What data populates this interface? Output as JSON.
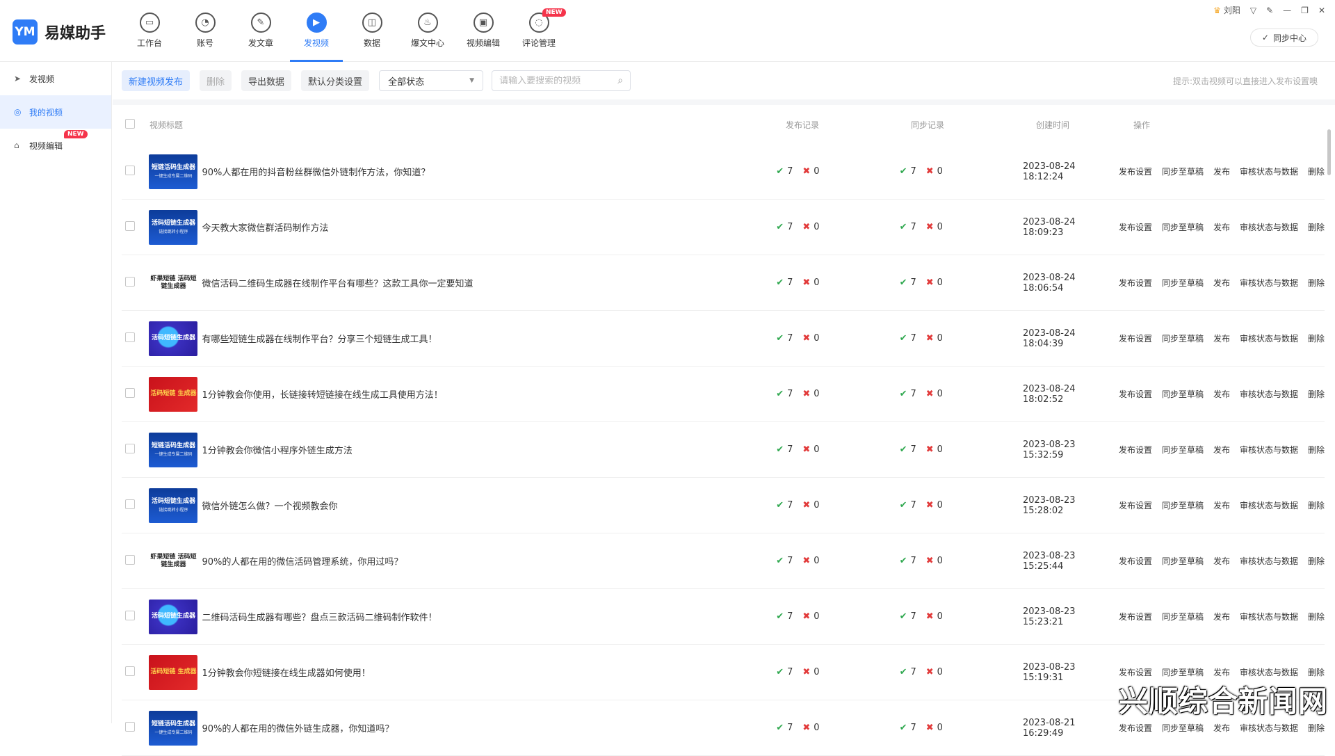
{
  "app": {
    "logo_mark": "YM",
    "name": "易媒助手"
  },
  "nav": [
    {
      "label": "工作台",
      "icon": "monitor-icon",
      "glyph": "▭"
    },
    {
      "label": "账号",
      "icon": "user-icon",
      "glyph": "◔"
    },
    {
      "label": "发文章",
      "icon": "feather-icon",
      "glyph": "✎"
    },
    {
      "label": "发视频",
      "icon": "play-icon",
      "glyph": "▶",
      "active": true
    },
    {
      "label": "数据",
      "icon": "chart-icon",
      "glyph": "◫"
    },
    {
      "label": "爆文中心",
      "icon": "flame-icon",
      "glyph": "♨"
    },
    {
      "label": "视频编辑",
      "icon": "briefcase-icon",
      "glyph": "▣"
    },
    {
      "label": "评论管理",
      "icon": "comment-icon",
      "glyph": "◌",
      "badge": "NEW"
    }
  ],
  "window": {
    "user_name": "刘阳",
    "sync_center": "同步中心"
  },
  "sidebar": [
    {
      "label": "发视频",
      "icon": "send-icon",
      "glyph": "➤"
    },
    {
      "label": "我的视频",
      "icon": "video-list-icon",
      "glyph": "◎",
      "active": true
    },
    {
      "label": "视频编辑",
      "icon": "edit-box-icon",
      "glyph": "⌂",
      "badge": "NEW"
    }
  ],
  "toolbar": {
    "new_publish": "新建视频发布",
    "delete": "删除",
    "export": "导出数据",
    "default_category": "默认分类设置",
    "status_select": "全部状态",
    "search_placeholder": "请输入要搜索的视频",
    "hint": "提示:双击视频可以直接进入发布设置噢"
  },
  "table": {
    "headers": {
      "title": "视频标题",
      "publish": "发布记录",
      "sync": "同步记录",
      "created": "创建时间",
      "ops": "操作"
    },
    "ops": [
      "发布设置",
      "同步至草稿",
      "发布",
      "审核状态与数据",
      "删除"
    ],
    "rows": [
      {
        "thumb": "t-blue",
        "thumb_text": "短链活码生成器",
        "thumb_sub": "一键生成专属二维码",
        "title": "90%人都在用的抖音粉丝群微信外链制作方法，你知道？",
        "pub_ok": "7",
        "pub_fail": "0",
        "sync_ok": "7",
        "sync_fail": "0",
        "time": "2023-08-24 18:12:24"
      },
      {
        "thumb": "t-blue",
        "thumb_text": "活码短链生成器",
        "thumb_sub": "链接跳转小程序",
        "title": "今天教大家微信群活码制作方法",
        "pub_ok": "7",
        "pub_fail": "0",
        "sync_ok": "7",
        "sync_fail": "0",
        "time": "2023-08-24 18:09:23"
      },
      {
        "thumb": "t-white",
        "thumb_text": "虾果短链 活码短链生成器",
        "thumb_sub": "",
        "title": "微信活码二维码生成器在线制作平台有哪些？这款工具你一定要知道",
        "pub_ok": "7",
        "pub_fail": "0",
        "sync_ok": "7",
        "sync_fail": "0",
        "time": "2023-08-24 18:06:54"
      },
      {
        "thumb": "t-purple",
        "thumb_text": "活码短链生成器",
        "thumb_sub": "",
        "title": "有哪些短链生成器在线制作平台？分享三个短链生成工具！",
        "pub_ok": "7",
        "pub_fail": "0",
        "sync_ok": "7",
        "sync_fail": "0",
        "time": "2023-08-24 18:04:39"
      },
      {
        "thumb": "t-red",
        "thumb_text": "活码短链 生成器",
        "thumb_sub": "",
        "title": "1分钟教会你使用，长链接转短链接在线生成工具使用方法！",
        "pub_ok": "7",
        "pub_fail": "0",
        "sync_ok": "7",
        "sync_fail": "0",
        "time": "2023-08-24 18:02:52"
      },
      {
        "thumb": "t-blue",
        "thumb_text": "短链活码生成器",
        "thumb_sub": "一键生成专属二维码",
        "title": "1分钟教会你微信小程序外链生成方法",
        "pub_ok": "7",
        "pub_fail": "0",
        "sync_ok": "7",
        "sync_fail": "0",
        "time": "2023-08-23 15:32:59"
      },
      {
        "thumb": "t-blue",
        "thumb_text": "活码短链生成器",
        "thumb_sub": "链接跳转小程序",
        "title": "微信外链怎么做？一个视频教会你",
        "pub_ok": "7",
        "pub_fail": "0",
        "sync_ok": "7",
        "sync_fail": "0",
        "time": "2023-08-23 15:28:02"
      },
      {
        "thumb": "t-white",
        "thumb_text": "虾果短链 活码短链生成器",
        "thumb_sub": "",
        "title": "90%的人都在用的微信活码管理系统，你用过吗？",
        "pub_ok": "7",
        "pub_fail": "0",
        "sync_ok": "7",
        "sync_fail": "0",
        "time": "2023-08-23 15:25:44"
      },
      {
        "thumb": "t-purple",
        "thumb_text": "活码短链生成器",
        "thumb_sub": "",
        "title": "二维码活码生成器有哪些？盘点三款活码二维码制作软件！",
        "pub_ok": "7",
        "pub_fail": "0",
        "sync_ok": "7",
        "sync_fail": "0",
        "time": "2023-08-23 15:23:21"
      },
      {
        "thumb": "t-red",
        "thumb_text": "活码短链 生成器",
        "thumb_sub": "",
        "title": "1分钟教会你短链接在线生成器如何使用！",
        "pub_ok": "7",
        "pub_fail": "0",
        "sync_ok": "7",
        "sync_fail": "0",
        "time": "2023-08-23 15:19:31"
      },
      {
        "thumb": "t-blue",
        "thumb_text": "短链活码生成器",
        "thumb_sub": "一键生成专属二维码",
        "title": "90%的人都在用的微信外链生成器，你知道吗？",
        "pub_ok": "7",
        "pub_fail": "0",
        "sync_ok": "7",
        "sync_fail": "0",
        "time": "2023-08-21 16:29:49"
      }
    ]
  },
  "watermark": "兴顺综合新闻网"
}
